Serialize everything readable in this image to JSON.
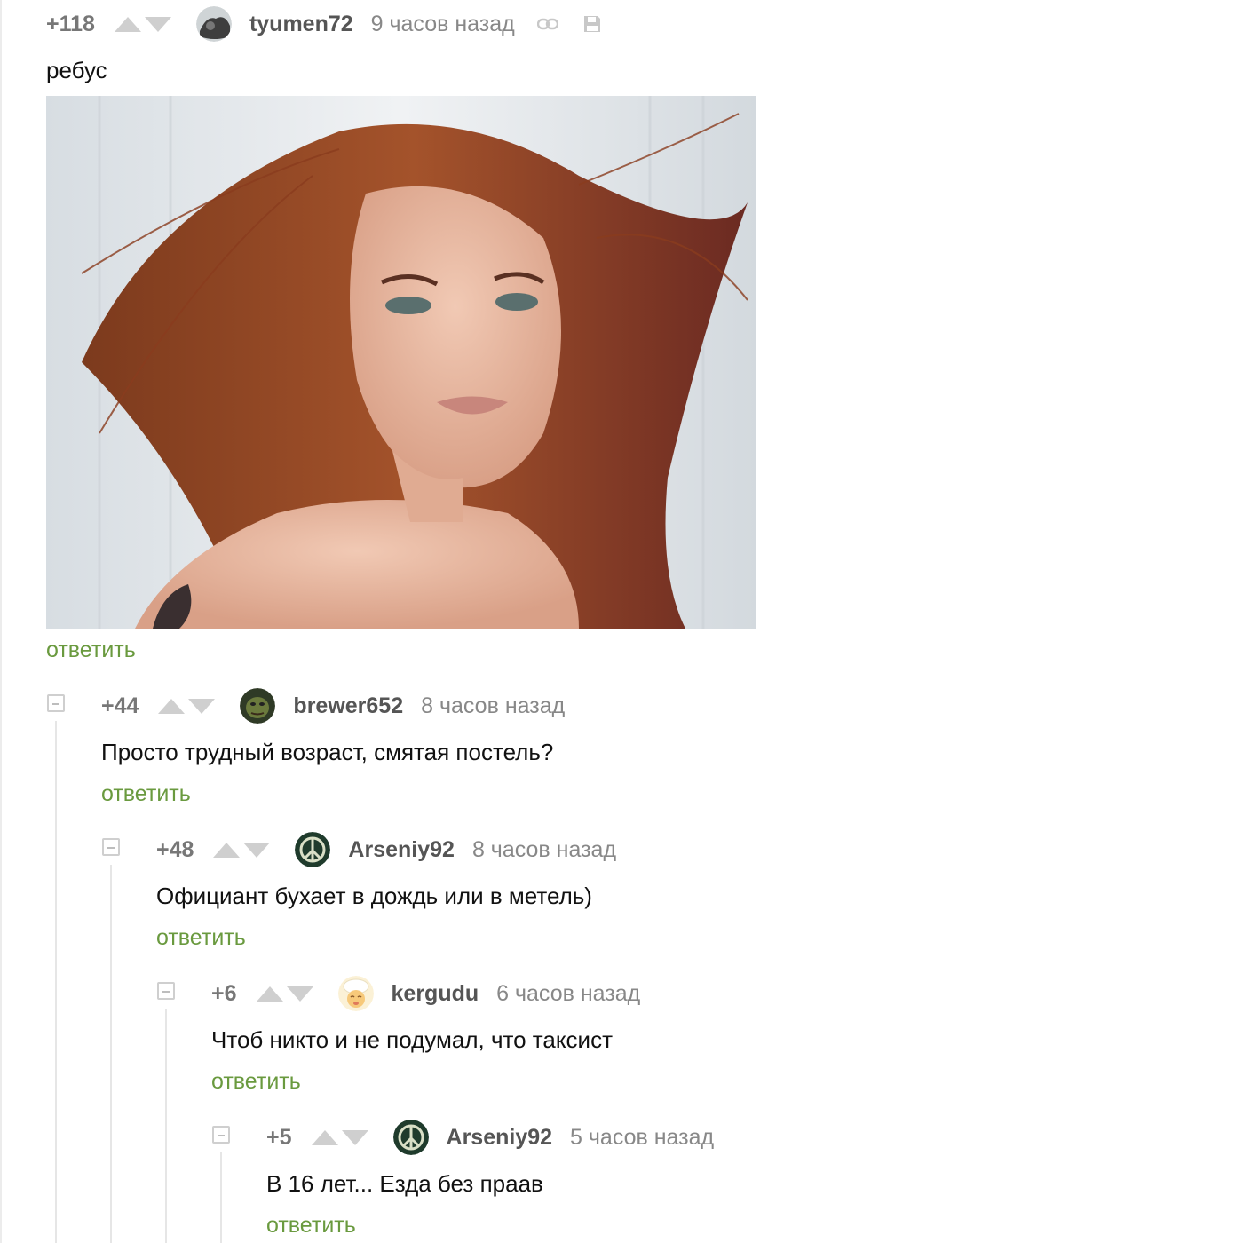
{
  "root": {
    "rating": "+118",
    "username": "tyumen72",
    "time": "9 часов назад",
    "text": "ребус",
    "reply": "ответить"
  },
  "comments": [
    {
      "rating": "+44",
      "username": "brewer652",
      "time": "8 часов назад",
      "text": "Просто трудный возраст, смятая постель?",
      "reply": "ответить"
    },
    {
      "rating": "+48",
      "username": "Arseniy92",
      "time": "8 часов назад",
      "text": "Официант бухает в дождь или в метель)",
      "reply": "ответить"
    },
    {
      "rating": "+6",
      "username": "kergudu",
      "time": "6 часов назад",
      "text": "Чтоб никто и не подумал, что таксист",
      "reply": "ответить"
    },
    {
      "rating": "+5",
      "username": "Arseniy92",
      "time": "5 часов назад",
      "text": "В 16 лет... Езда без праав",
      "reply": "ответить"
    }
  ],
  "icons": {
    "vote_up": "triangle-up-icon",
    "vote_down": "triangle-down-icon",
    "link": "link-icon",
    "save": "floppy-disk-icon",
    "collapse": "minus-square-icon"
  },
  "colors": {
    "reply_link": "#6a9a3f",
    "meta": "#888888",
    "vote_arrow": "#cfcfcf"
  }
}
